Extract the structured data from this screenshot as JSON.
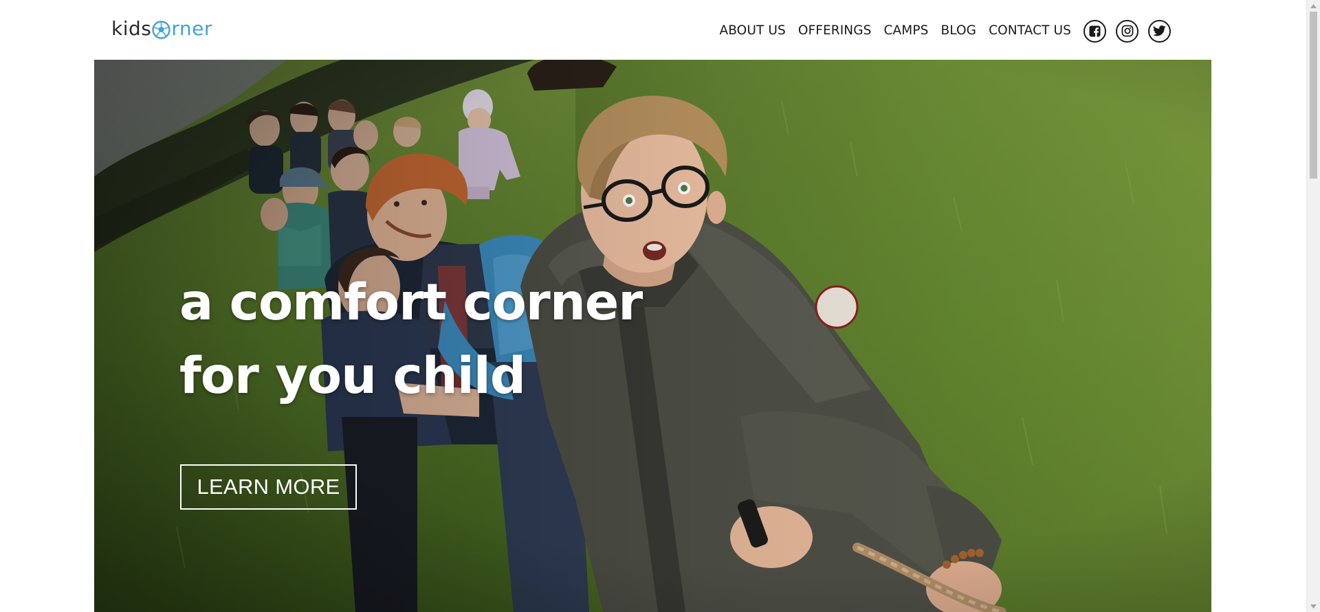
{
  "header": {
    "logo": {
      "text_before": "kids",
      "text_after": "rner",
      "ball_icon": "soccer-ball-icon",
      "colors": {
        "dark": "#2b2b2b",
        "blue": "#3ea3d8"
      }
    },
    "nav": [
      {
        "label": "ABOUT US"
      },
      {
        "label": "OFFERINGS"
      },
      {
        "label": "CAMPS"
      },
      {
        "label": "BLOG"
      },
      {
        "label": "CONTACT US"
      }
    ],
    "social": [
      {
        "icon": "facebook-icon"
      },
      {
        "icon": "instagram-icon"
      },
      {
        "icon": "twitter-icon"
      }
    ]
  },
  "hero": {
    "title_line1": "a comfort corner",
    "title_line2": "for you child",
    "cta_label": "LEARN MORE",
    "colors": {
      "text": "#ffffff",
      "grass": "#5a7a2e"
    }
  }
}
